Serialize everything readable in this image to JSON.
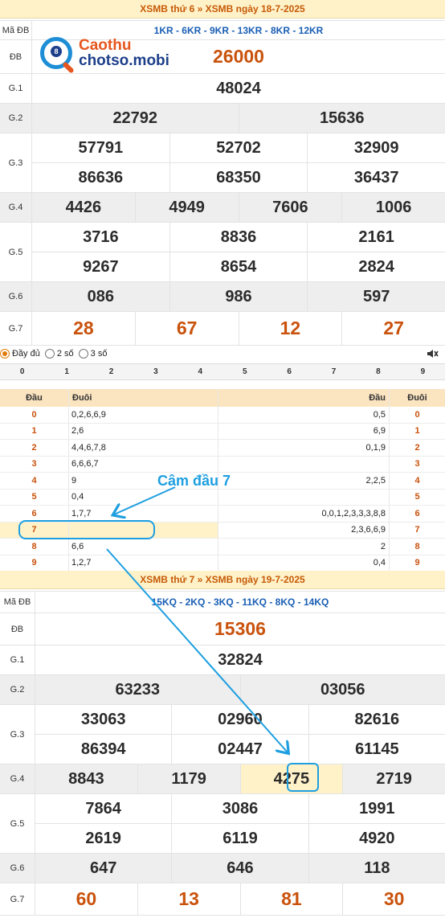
{
  "draw1": {
    "header": "XSMB thứ 6 » XSMB ngày 18-7-2025",
    "madb_label": "Mã ĐB",
    "madb": "1KR - 6KR - 9KR - 13KR - 8KR - 12KR",
    "logo": {
      "line1": "Caothu",
      "line2": "chotso.mobi",
      "badge": "8"
    },
    "labels": {
      "db": "ĐB",
      "g1": "G.1",
      "g2": "G.2",
      "g3": "G.3",
      "g4": "G.4",
      "g5": "G.5",
      "g6": "G.6",
      "g7": "G.7"
    },
    "db": "26000",
    "g1": "48024",
    "g2": [
      "22792",
      "15636"
    ],
    "g3": [
      "57791",
      "52702",
      "32909",
      "86636",
      "68350",
      "36437"
    ],
    "g4": [
      "4426",
      "4949",
      "7606",
      "1006"
    ],
    "g5": [
      "3716",
      "8836",
      "2161",
      "9267",
      "8654",
      "2824"
    ],
    "g6": [
      "086",
      "986",
      "597"
    ],
    "g7": [
      "28",
      "67",
      "12",
      "27"
    ]
  },
  "options": {
    "full": "Đầy đủ",
    "two": "2 số",
    "three": "3 số",
    "selected": "full"
  },
  "digits": [
    "0",
    "1",
    "2",
    "3",
    "4",
    "5",
    "6",
    "7",
    "8",
    "9"
  ],
  "loto": {
    "head": {
      "dau": "Đầu",
      "duoi": "Đuôi",
      "dau2": "Đầu",
      "duoi2": "Đuôi"
    },
    "rows": [
      {
        "d": "0",
        "tail": "0,2,6,6,9",
        "head": "0,5",
        "d2": "0"
      },
      {
        "d": "1",
        "tail": "2,6",
        "head": "6,9",
        "d2": "1"
      },
      {
        "d": "2",
        "tail": "4,4,6,7,8",
        "head": "0,1,9",
        "d2": "2"
      },
      {
        "d": "3",
        "tail": "6,6,6,7",
        "head": "",
        "d2": "3"
      },
      {
        "d": "4",
        "tail": "9",
        "head": "2,2,5",
        "d2": "4"
      },
      {
        "d": "5",
        "tail": "0,4",
        "head": "",
        "d2": "5"
      },
      {
        "d": "6",
        "tail": "1,7,7",
        "head": "0,0,1,2,3,3,3,8,8",
        "d2": "6"
      },
      {
        "d": "7",
        "tail": "",
        "head": "2,3,6,6,9",
        "d2": "7"
      },
      {
        "d": "8",
        "tail": "6,6",
        "head": "2",
        "d2": "8"
      },
      {
        "d": "9",
        "tail": "1,2,7",
        "head": "0,4",
        "d2": "9"
      }
    ]
  },
  "annotation": "Câm đầu 7",
  "draw2": {
    "header": "XSMB thứ 7 » XSMB ngày 19-7-2025",
    "madb_label": "Mã ĐB",
    "madb": "15KQ - 2KQ - 3KQ - 11KQ - 8KQ - 14KQ",
    "labels": {
      "db": "ĐB",
      "g1": "G.1",
      "g2": "G.2",
      "g3": "G.3",
      "g4": "G.4",
      "g5": "G.5",
      "g6": "G.6",
      "g7": "G.7"
    },
    "db": "15306",
    "g1": "32824",
    "g2": [
      "63233",
      "03056"
    ],
    "g3": [
      "33063",
      "02960",
      "82616",
      "86394",
      "02447",
      "61145"
    ],
    "g4": [
      "8843",
      "1179",
      "4275",
      "2719"
    ],
    "g5": [
      "7864",
      "3086",
      "1991",
      "2619",
      "6119",
      "4920"
    ],
    "g6": [
      "647",
      "646",
      "118"
    ],
    "g7": [
      "60",
      "13",
      "81",
      "30"
    ]
  },
  "colors": {
    "accent": "#c9520c",
    "blue": "#1d3f8a",
    "annotation": "#1e9fe0",
    "highlight": "#fff2c9"
  }
}
